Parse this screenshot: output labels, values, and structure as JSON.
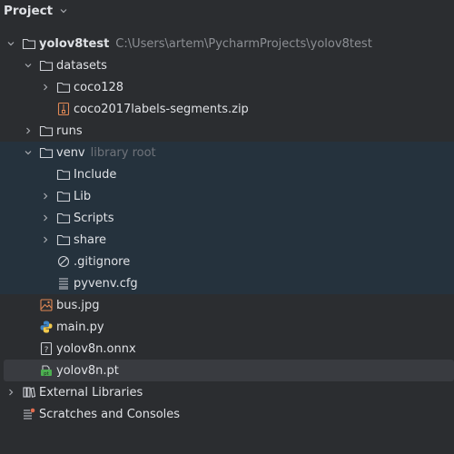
{
  "panel": {
    "title": "Project"
  },
  "tree": {
    "root": {
      "name": "yolov8test",
      "path": "C:\\Users\\artem\\PycharmProjects\\yolov8test"
    },
    "datasets": {
      "name": "datasets"
    },
    "coco128": {
      "name": "coco128"
    },
    "coco_zip": {
      "name": "coco2017labels-segments.zip"
    },
    "runs": {
      "name": "runs"
    },
    "venv": {
      "name": "venv",
      "hint": "library root"
    },
    "include": {
      "name": "Include"
    },
    "lib": {
      "name": "Lib"
    },
    "scripts": {
      "name": "Scripts"
    },
    "share": {
      "name": "share"
    },
    "gitignore": {
      "name": ".gitignore"
    },
    "pyvenv": {
      "name": "pyvenv.cfg"
    },
    "bus": {
      "name": "bus.jpg"
    },
    "main": {
      "name": "main.py"
    },
    "onnx": {
      "name": "yolov8n.onnx"
    },
    "pt": {
      "name": "yolov8n.pt"
    },
    "external": {
      "name": "External Libraries"
    },
    "scratches": {
      "name": "Scratches and Consoles"
    }
  },
  "colors": {
    "background": "#2b2d30",
    "venv_highlight": "#25323d",
    "selection": "#393b40"
  }
}
